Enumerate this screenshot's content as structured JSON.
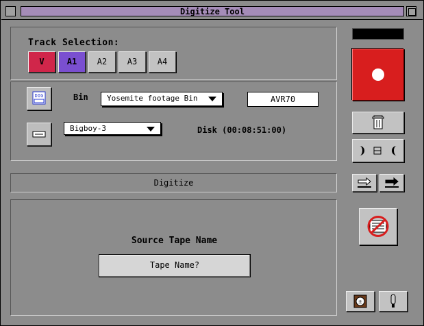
{
  "window": {
    "title": "Digitize Tool"
  },
  "track_selection": {
    "title": "Track Selection:",
    "tracks": [
      {
        "label": "V",
        "state": "selected-red"
      },
      {
        "label": "A1",
        "state": "selected-purple"
      },
      {
        "label": "A2",
        "state": "off"
      },
      {
        "label": "A3",
        "state": "off"
      },
      {
        "label": "A4",
        "state": "off"
      }
    ]
  },
  "bin": {
    "label": "Bin",
    "selected": "Yosemite footage Bin",
    "resolution": "AVR70"
  },
  "device": {
    "selected": "Bigboy-3",
    "disk_label": "Disk (00:08:51:00)"
  },
  "mode": {
    "label": "Digitize"
  },
  "tape": {
    "label": "Source Tape Name",
    "value": "Tape Name?"
  },
  "icons": {
    "dig": "DIG",
    "record": "record-icon",
    "trash": "trash-icon",
    "audio": "audio-icon"
  },
  "colors": {
    "title_strip": "#a58cb8",
    "video_track": "#d0264a",
    "audio_track": "#7a4fd0",
    "record": "#d81e1e"
  }
}
